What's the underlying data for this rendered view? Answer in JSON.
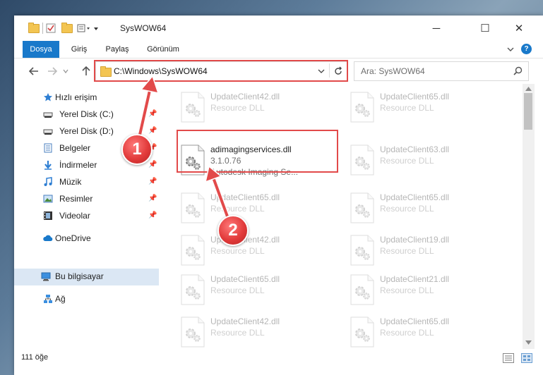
{
  "window": {
    "title": "SysWOW64",
    "minimize_label": "─",
    "maximize_label": "☐",
    "close_label": "✕"
  },
  "ribbon": {
    "tabs": [
      "Dosya",
      "Giriş",
      "Paylaş",
      "Görünüm"
    ],
    "help_label": "?"
  },
  "address": {
    "path": "C:\\Windows\\SysWOW64",
    "search_placeholder": "Ara: SysWOW64"
  },
  "sidebar": {
    "items": [
      {
        "label": "Hızlı erişim",
        "icon": "star-icon",
        "pinned": false
      },
      {
        "label": "Yerel Disk (C:)",
        "icon": "drive-icon",
        "pinned": true
      },
      {
        "label": "Yerel Disk (D:)",
        "icon": "drive-icon",
        "pinned": true
      },
      {
        "label": "Belgeler",
        "icon": "documents-icon",
        "pinned": true
      },
      {
        "label": "İndirmeler",
        "icon": "download-icon",
        "pinned": true
      },
      {
        "label": "Müzik",
        "icon": "music-icon",
        "pinned": true
      },
      {
        "label": "Resimler",
        "icon": "pictures-icon",
        "pinned": true
      },
      {
        "label": "Videolar",
        "icon": "video-icon",
        "pinned": true
      },
      {
        "label": "OneDrive",
        "icon": "cloud-icon",
        "pinned": false
      },
      {
        "label": "Bu bilgisayar",
        "icon": "computer-icon",
        "pinned": false,
        "selected": true
      },
      {
        "label": "Ağ",
        "icon": "network-icon",
        "pinned": false
      }
    ],
    "pin_glyph": "📌"
  },
  "files": {
    "left": [
      {
        "name": "UpdateClient42.dll",
        "type": "Resource DLL",
        "faded": true
      },
      {
        "name": "adimagingservices.dll",
        "version": "3.1.0.76",
        "desc": "Autodesk Imaging Se...",
        "faded": false
      },
      {
        "name": "UpdateClient65.dll",
        "type": "Resource DLL",
        "faded": true
      },
      {
        "name": "UpdateClient42.dll",
        "type": "Resource DLL",
        "faded": true
      },
      {
        "name": "UpdateClient65.dll",
        "type": "Resource DLL",
        "faded": true
      },
      {
        "name": "UpdateClient42.dll",
        "type": "Resource DLL",
        "faded": true
      }
    ],
    "right": [
      {
        "name": "UpdateClient65.dll",
        "type": "Resource DLL",
        "faded": true
      },
      {
        "name": "UpdateClient63.dll",
        "type": "Resource DLL",
        "faded": true
      },
      {
        "name": "UpdateClient65.dll",
        "type": "Resource DLL",
        "faded": true
      },
      {
        "name": "UpdateClient19.dll",
        "type": "Resource DLL",
        "faded": true
      },
      {
        "name": "UpdateClient21.dll",
        "type": "Resource DLL",
        "faded": true
      },
      {
        "name": "UpdateClient65.dll",
        "type": "Resource DLL",
        "faded": true
      }
    ]
  },
  "status": {
    "item_count": "111 öğe"
  },
  "annotations": {
    "step1": "1",
    "step2": "2",
    "color": "#e24a4a"
  }
}
